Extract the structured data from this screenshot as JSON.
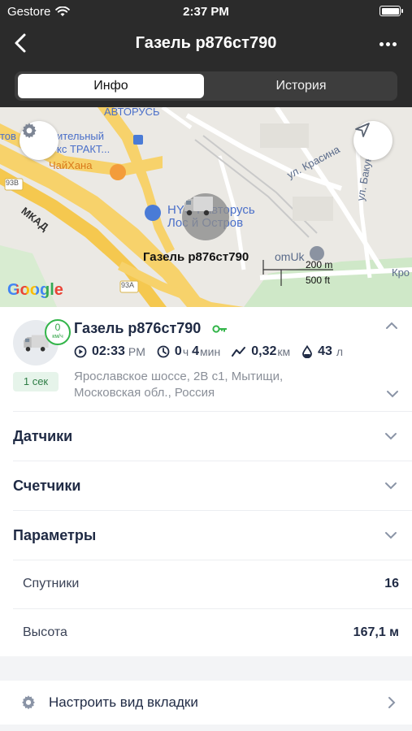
{
  "status_bar": {
    "carrier": "Gestore",
    "time": "2:37 PM"
  },
  "nav": {
    "title": "Газель р876ст790"
  },
  "tabs": [
    {
      "label": "Инфо",
      "active": true
    },
    {
      "label": "История",
      "active": false
    }
  ],
  "map": {
    "labels": {
      "autorus_top": "АВТОРУСЬ",
      "complex_line1": "тов",
      "complex_line2": "ительный",
      "complex_line3": "кс ТРАКТ...",
      "chaihana": "ЧайХана",
      "krasina": "ул. Красина",
      "bakun": "ул. Бакун",
      "mkad": "МКАД",
      "road_93b": "93В",
      "road_93a": "93А",
      "hyundai_line1": "HYU   I Авторусь",
      "hyundai_line2": "Лос   й Остров",
      "omuk": "omUk",
      "kro": "Кро"
    },
    "vehicle_label": "Газель р876ст790",
    "scale_top": "200 m",
    "scale_bottom": "500 ft",
    "attribution": "Google"
  },
  "vehicle": {
    "name": "Газель р876ст790",
    "speed_value": "0",
    "speed_unit": "км/ч",
    "age": "1 сек",
    "time_value": "02:33",
    "time_suffix": "PM",
    "duration_h": "0",
    "duration_h_unit": "ч",
    "duration_m": "4",
    "duration_m_unit": "мин",
    "distance_value": "0,32",
    "distance_unit": "км",
    "fuel_value": "43",
    "fuel_unit": "л",
    "address": "Ярославское шоссе, 2В с1, Мытищи, Московская обл., Россия"
  },
  "sections": [
    {
      "label": "Датчики"
    },
    {
      "label": "Счетчики"
    },
    {
      "label": "Параметры"
    }
  ],
  "parameters": [
    {
      "name": "Спутники",
      "value": "16"
    },
    {
      "name": "Высота",
      "value": "167,1 м"
    }
  ],
  "settings": {
    "label": "Настроить вид вкладки"
  },
  "colors": {
    "topbar": "#2b2b2b",
    "accent_green": "#33b54a",
    "text_dark": "#1f2a44"
  }
}
